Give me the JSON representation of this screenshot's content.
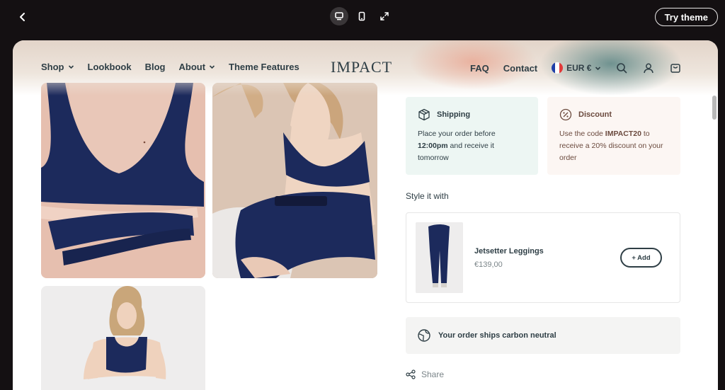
{
  "editor": {
    "try_label": "Try theme",
    "icons": [
      "chevron-left-icon",
      "desktop-icon",
      "mobile-icon",
      "expand-icon"
    ]
  },
  "header": {
    "logo": "IMPACT",
    "nav_left": [
      {
        "label": "Shop",
        "dropdown": true
      },
      {
        "label": "Lookbook",
        "dropdown": false
      },
      {
        "label": "Blog",
        "dropdown": false
      },
      {
        "label": "About",
        "dropdown": true
      },
      {
        "label": "Theme Features",
        "dropdown": false
      }
    ],
    "nav_right": [
      "FAQ",
      "Contact"
    ],
    "currency": "EUR €",
    "icons": [
      "search-icon",
      "account-icon",
      "cart-icon"
    ]
  },
  "info": {
    "shipping": {
      "title": "Shipping",
      "text_before": "Place your order before ",
      "text_bold": "12:00pm",
      "text_after": " and receive it tomorrow"
    },
    "discount": {
      "title": "Discount",
      "text_before": "Use the code ",
      "text_bold": "IMPACT20",
      "text_after": " to receive a 20% discount on your order"
    }
  },
  "recommend": {
    "title": "Style it with",
    "product_name": "Jetsetter Leggings",
    "price": "€139,00",
    "add_label": "+ Add"
  },
  "carbon_text": "Your order ships carbon neutral",
  "share_label": "Share",
  "colors": {
    "ink": "#2e3e45",
    "shipping_bg": "#edf6f3",
    "discount_bg": "#fcf6f3",
    "discount_ink": "#6b4a3e",
    "navy": "#1c2a5c"
  }
}
